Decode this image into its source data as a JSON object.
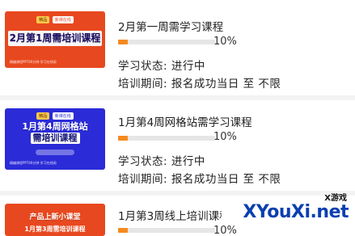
{
  "courses": [
    {
      "thumb_badges": [
        "精品",
        "新课在线"
      ],
      "thumb_title": "2月第1周需培训课程",
      "thumb_footer": "精编课程PPT40分钟  学习在线阅",
      "title": "2月第一周需学习课程",
      "progress": 10,
      "percent_text": "10%",
      "status": "学习状态: 进行中",
      "period": "培训期间: 报名成功当日 至 不限"
    },
    {
      "thumb_badges": [
        "精品",
        "新课在线"
      ],
      "thumb_title_line1": "1月第4周网格站",
      "thumb_title_line2": "需培训课程",
      "thumb_footer": "精编课程PPT40分钟  学习在线阅",
      "title": "1月第4周网格站需学习课程",
      "progress": 10,
      "percent_text": "10%",
      "status": "学习状态: 进行中",
      "period": "培训期间: 报名成功当日 至 不限"
    },
    {
      "thumb_title": "产品上新小课堂",
      "thumb_sub": "1月第3周需培训课程",
      "title": "1月第3周线上培训课程",
      "progress": 10,
      "percent_text": "10%"
    }
  ],
  "watermark": {
    "tag": "X游戏",
    "text": "XYouXi.net"
  },
  "colors": {
    "progress_fill": "#f58a1f",
    "progress_track": "#e6e6e6",
    "thumb_red": "#e8481f",
    "thumb_blue": "#2b2bd8"
  }
}
